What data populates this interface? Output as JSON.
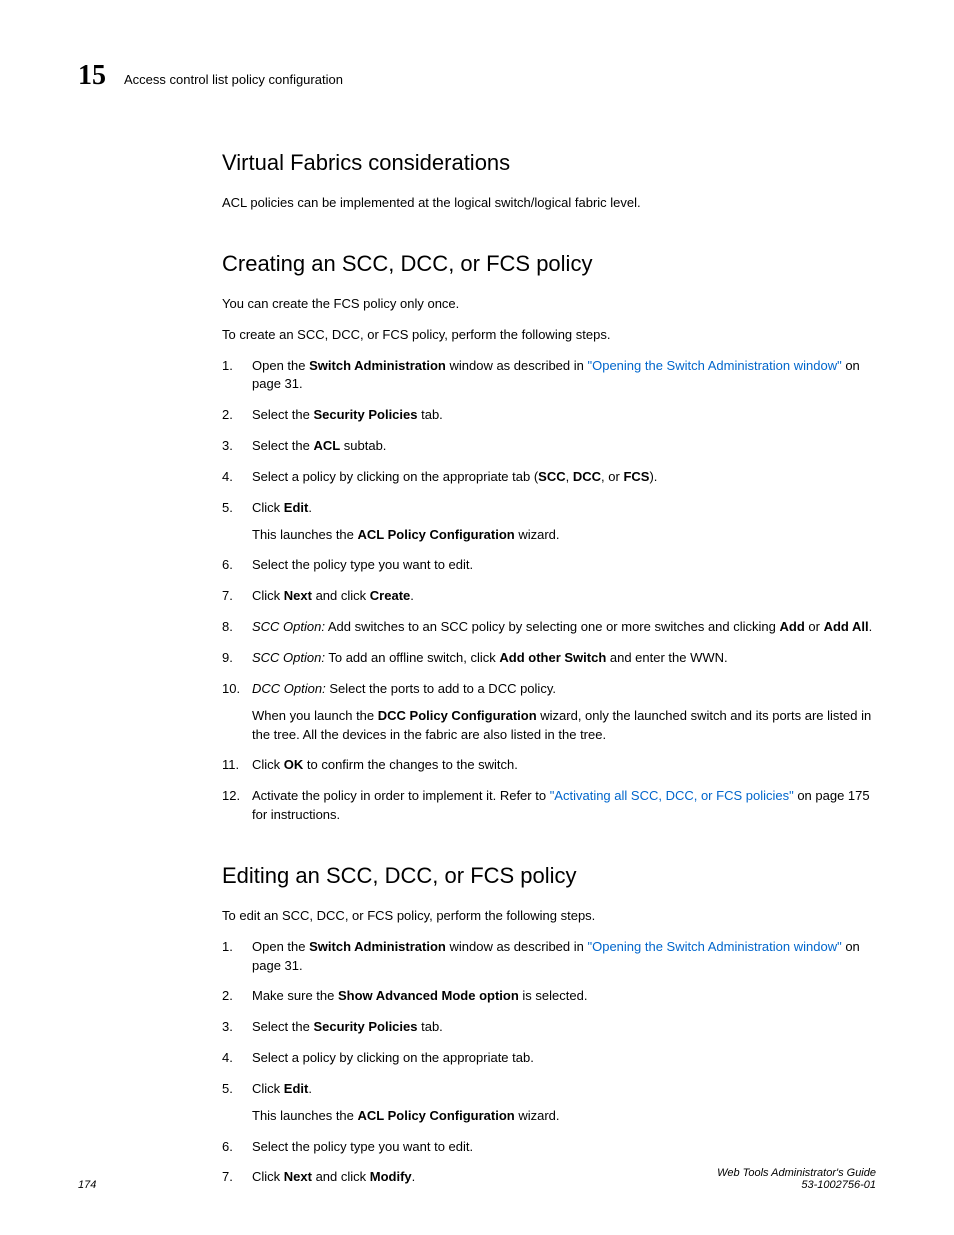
{
  "header": {
    "chapter_number": "15",
    "chapter_title": "Access control list policy configuration"
  },
  "sections": {
    "s1": {
      "heading": "Virtual Fabrics considerations",
      "p1": "ACL policies can be implemented at the logical switch/logical fabric level."
    },
    "s2": {
      "heading": "Creating an SCC, DCC, or FCS policy",
      "p1": "You can create the FCS policy only once.",
      "p2": "To create an SCC, DCC, or FCS policy, perform the following steps.",
      "steps": {
        "i1_a": "Open the ",
        "i1_b": "Switch Administration",
        "i1_c": " window as described in ",
        "i1_link": "\"Opening the Switch Administration window\"",
        "i1_d": " on page 31.",
        "i2_a": "Select the ",
        "i2_b": "Security Policies",
        "i2_c": " tab.",
        "i3_a": "Select the ",
        "i3_b": "ACL",
        "i3_c": " subtab.",
        "i4_a": "Select a policy by clicking on the appropriate tab (",
        "i4_b": "SCC",
        "i4_c": ", ",
        "i4_d": "DCC",
        "i4_e": ", or ",
        "i4_f": "FCS",
        "i4_g": ").",
        "i5_a": "Click ",
        "i5_b": "Edit",
        "i5_c": ".",
        "i5_sub_a": "This launches the ",
        "i5_sub_b": "ACL Policy Configuration",
        "i5_sub_c": " wizard.",
        "i6": "Select the policy type you want to edit.",
        "i7_a": "Click ",
        "i7_b": "Next",
        "i7_c": " and click ",
        "i7_d": "Create",
        "i7_e": ".",
        "i8_a": "SCC Option:",
        "i8_b": " Add switches to an SCC policy by selecting one or more switches and clicking ",
        "i8_c": "Add",
        "i8_d": " or ",
        "i8_e": "Add All",
        "i8_f": ".",
        "i9_a": "SCC Option:",
        "i9_b": " To add an offline switch, click ",
        "i9_c": "Add other Switch",
        "i9_d": " and enter the WWN.",
        "i10_a": "DCC Option:",
        "i10_b": " Select the ports to add to a DCC policy.",
        "i10_sub_a": "When you launch the ",
        "i10_sub_b": "DCC Policy Configuration",
        "i10_sub_c": " wizard, only the launched switch and its ports are listed in the tree. All the devices in the fabric are also listed in the tree.",
        "i11_a": "Click ",
        "i11_b": "OK",
        "i11_c": " to confirm the changes to the switch.",
        "i12_a": "Activate the policy in order to implement it. Refer to ",
        "i12_link": "\"Activating all SCC, DCC, or FCS policies\"",
        "i12_b": " on page 175 for instructions."
      }
    },
    "s3": {
      "heading": "Editing an SCC, DCC, or FCS policy",
      "p1": "To edit an SCC, DCC, or FCS policy, perform the following steps.",
      "steps": {
        "i1_a": "Open the ",
        "i1_b": "Switch Administration",
        "i1_c": " window as described in ",
        "i1_link": "\"Opening the Switch Administration window\"",
        "i1_d": " on page 31.",
        "i2_a": "Make sure the ",
        "i2_b": "Show Advanced Mode option",
        "i2_c": " is selected.",
        "i3_a": "Select the ",
        "i3_b": "Security Policies",
        "i3_c": " tab.",
        "i4": "Select a policy by clicking on the appropriate tab.",
        "i5_a": "Click ",
        "i5_b": "Edit",
        "i5_c": ".",
        "i5_sub_a": "This launches the ",
        "i5_sub_b": "ACL Policy Configuration",
        "i5_sub_c": " wizard.",
        "i6": "Select the policy type you want to edit.",
        "i7_a": "Click ",
        "i7_b": "Next",
        "i7_c": " and click ",
        "i7_d": "Modify",
        "i7_e": "."
      }
    }
  },
  "footer": {
    "page_num": "174",
    "doc_title": "Web Tools Administrator's Guide",
    "doc_id": "53-1002756-01"
  }
}
